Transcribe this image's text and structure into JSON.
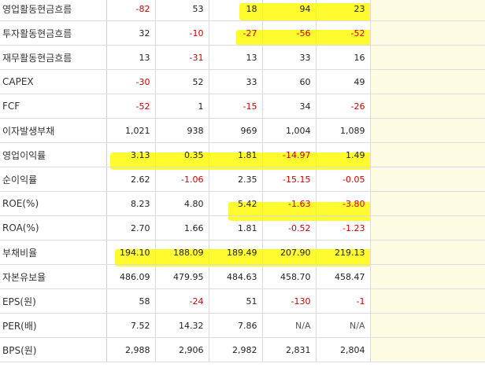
{
  "rows": [
    {
      "label": "영업활동현금흐름",
      "values": [
        "-82",
        "53",
        "18",
        "94",
        "23"
      ]
    },
    {
      "label": "투자활동현금흐름",
      "values": [
        "32",
        "-10",
        "-27",
        "-56",
        "-52"
      ]
    },
    {
      "label": "재무활동현금흐름",
      "values": [
        "13",
        "-31",
        "13",
        "33",
        "16"
      ]
    },
    {
      "label": "CAPEX",
      "values": [
        "-30",
        "52",
        "33",
        "60",
        "49"
      ]
    },
    {
      "label": "FCF",
      "values": [
        "-52",
        "1",
        "-15",
        "34",
        "-26"
      ]
    },
    {
      "label": "이자발생부채",
      "values": [
        "1,021",
        "938",
        "969",
        "1,004",
        "1,089"
      ]
    },
    {
      "label": "영업이익률",
      "values": [
        "3.13",
        "0.35",
        "1.81",
        "-14.97",
        "1.49"
      ]
    },
    {
      "label": "순이익률",
      "values": [
        "2.62",
        "-1.06",
        "2.35",
        "-15.15",
        "-0.05"
      ]
    },
    {
      "label": "ROE(%)",
      "values": [
        "8.23",
        "4.80",
        "5.42",
        "-1.63",
        "-3.80"
      ]
    },
    {
      "label": "ROA(%)",
      "values": [
        "2.70",
        "1.66",
        "1.81",
        "-0.52",
        "-1.23"
      ]
    },
    {
      "label": "부채비율",
      "values": [
        "194.10",
        "188.09",
        "189.49",
        "207.90",
        "219.13"
      ]
    },
    {
      "label": "자본유보율",
      "values": [
        "486.09",
        "479.95",
        "484.63",
        "458.70",
        "458.47"
      ]
    },
    {
      "label": "EPS(원)",
      "values": [
        "58",
        "-24",
        "51",
        "-130",
        "-1"
      ]
    },
    {
      "label": "PER(배)",
      "values": [
        "7.52",
        "14.32",
        "7.86",
        "N/A",
        "N/A"
      ]
    },
    {
      "label": "BPS(원)",
      "values": [
        "2,988",
        "2,906",
        "2,982",
        "2,831",
        "2,804"
      ]
    }
  ],
  "colors": {
    "negative": "#cc0000",
    "highlight": "#fffb00",
    "empty_column": "#fdfbe1"
  }
}
